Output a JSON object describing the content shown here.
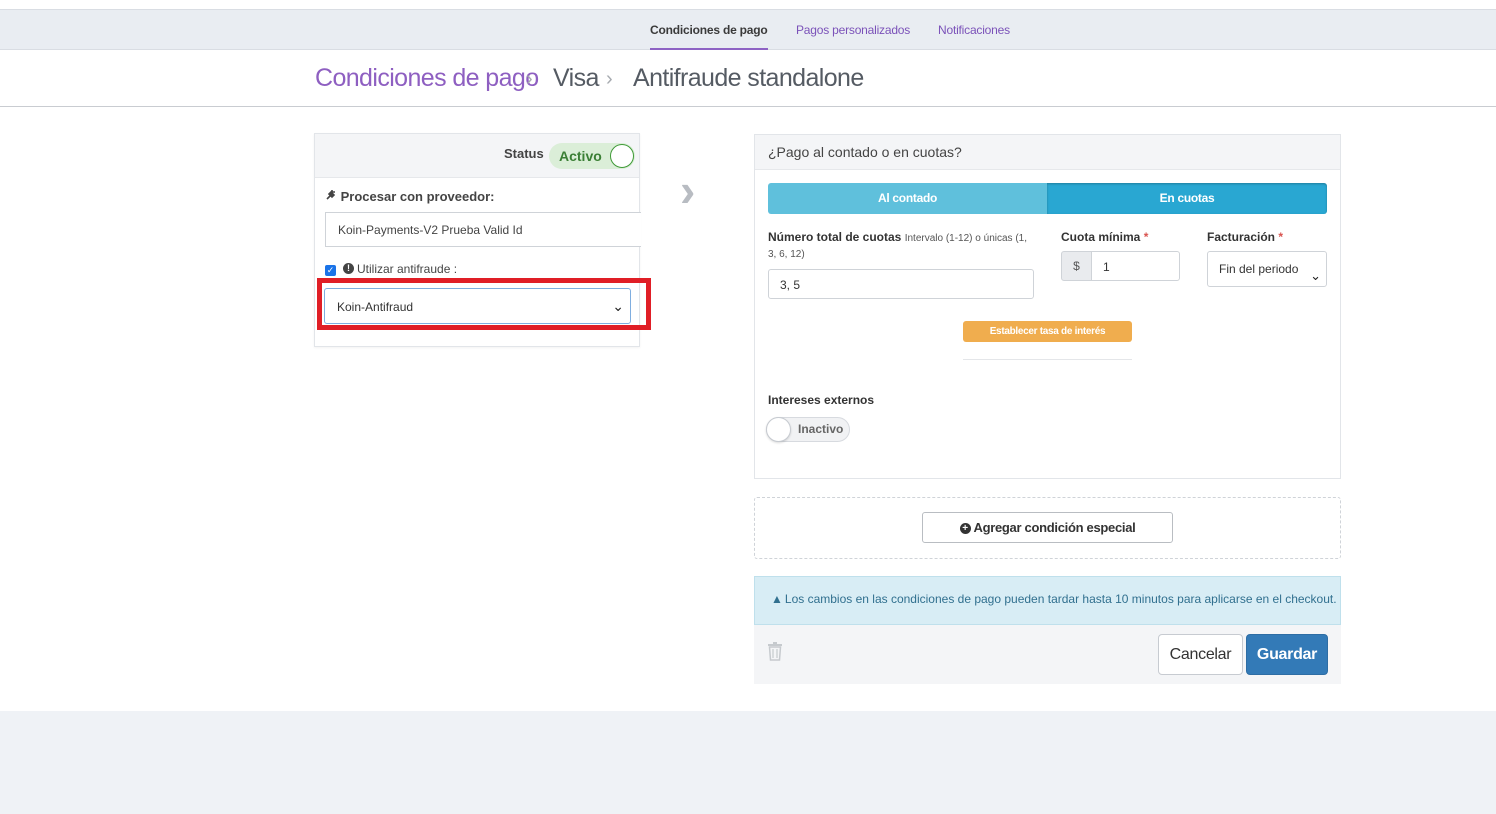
{
  "nav": {
    "tabs": [
      {
        "label": "Condiciones de pago",
        "active": true
      },
      {
        "label": "Pagos personalizados",
        "active": false
      },
      {
        "label": "Notificaciones",
        "active": false
      }
    ]
  },
  "breadcrumb": {
    "items": [
      "Condiciones de pago",
      "Visa",
      "Antifraude standalone"
    ],
    "separator": ">"
  },
  "left_panel": {
    "status_label": "Status",
    "status_value": "Activo",
    "provider_label": "Procesar con proveedor:",
    "provider_value": "Koin-Payments-V2 Prueba Valid Id",
    "antifraud_checked": true,
    "antifraud_label": "Utilizar antifraude :",
    "antifraud_selected": "Koin-Antifraud",
    "highlight_color": "#e01e26"
  },
  "right_panel": {
    "title": "¿Pago al contado o en cuotas?",
    "segments": [
      "Al contado",
      "En cuotas"
    ],
    "selected_segment": "En cuotas",
    "cuotas_label": "Número total de cuotas",
    "cuotas_hint_1": "Intervalo (1-12) o únicas (1,",
    "cuotas_hint_2": "3, 6, 12)",
    "cuotas_value": "3, 5",
    "cuota_min_label": "Cuota mínima",
    "required_mark": "*",
    "currency_symbol": "$",
    "cuota_min_value": "1",
    "facturacion_label": "Facturación",
    "facturacion_value": "Fin del periodo",
    "interest_button": "Establecer tasa de interés",
    "external_interest_label": "Intereses externos",
    "external_interest_state": "Inactivo"
  },
  "special": {
    "add_button": "Agregar condición especial"
  },
  "info": {
    "message": "Los cambios en las condiciones de pago pueden tardar hasta 10 minutos para aplicarse en el checkout."
  },
  "actions": {
    "cancel": "Cancelar",
    "save": "Guardar"
  },
  "colors": {
    "accent_purple": "#8e5fc1",
    "segment_light": "#5fc0dc",
    "segment_active": "#29a7d2",
    "primary": "#337ab7",
    "warning": "#f0ad4e",
    "success_toggle": "#3f9a37"
  },
  "icons": [
    "plug-icon",
    "info-circle-icon",
    "chevron-right-icon",
    "plus-circle-icon",
    "warning-triangle-icon",
    "trash-icon",
    "chevron-down-icon"
  ]
}
